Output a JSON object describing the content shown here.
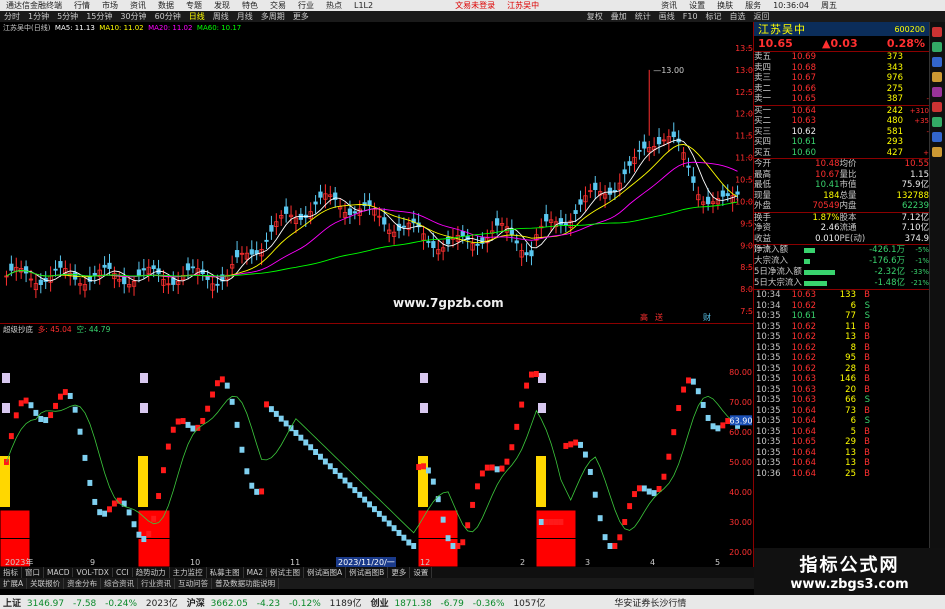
{
  "titlebar": {
    "app": "通达信金融终端",
    "menus": [
      "行情",
      "市场",
      "资讯",
      "数据",
      "专题",
      "发现",
      "特色",
      "交易",
      "行业",
      "热点",
      "L1L2"
    ],
    "trade_login": "文易未登录",
    "stock_name": "江苏吴中",
    "right": [
      "资讯",
      "设置",
      "换肤",
      "服务",
      "10:36:04",
      "周五"
    ]
  },
  "toolbar": {
    "periods": [
      "分时",
      "1分钟",
      "5分钟",
      "15分钟",
      "30分钟",
      "60分钟",
      "日线",
      "周线",
      "月线",
      "多周期",
      "更多"
    ],
    "active": "日线",
    "right": [
      "复权",
      "叠加",
      "统计",
      "画线",
      "F10",
      "标记",
      "自选",
      "返回"
    ]
  },
  "chart_info": {
    "stock": "江苏吴中(日线)",
    "ma5": "MA5: 11.13",
    "ma10": "MA10: 11.02",
    "ma20": "MA20: 11.02",
    "ma60": "MA60: 10.17"
  },
  "price_axis": [
    "13.50",
    "13.00",
    "12.50",
    "12.00",
    "11.50",
    "11.00",
    "10.50",
    "10.00",
    "9.50",
    "9.00",
    "8.50",
    "8.00",
    "7.50"
  ],
  "indicator_axis": [
    "80.00",
    "70.00",
    "60.00",
    "50.00",
    "40.00",
    "30.00",
    "20.00"
  ],
  "indicator_marker": "63.90",
  "high_label": "13.00",
  "watermark_top": "www.7gpzb.com",
  "indicator_head": {
    "name": "超级抄底",
    "v1": "多: 45.04",
    "v2": "空: 44.79"
  },
  "date_labels": [
    "2023年",
    "9",
    "10",
    "11",
    "2023/11/20/一",
    "12",
    "2",
    "3",
    "4",
    "5"
  ],
  "events": [
    "高",
    "送",
    "财"
  ],
  "side": {
    "name": "江苏吴中",
    "code": "600200",
    "price": "10.65",
    "change": "▲0.03",
    "pct": "0.28%",
    "asks": [
      {
        "label": "卖五",
        "price": "10.69",
        "vol": "373",
        "delta": ""
      },
      {
        "label": "卖四",
        "price": "10.68",
        "vol": "343",
        "delta": ""
      },
      {
        "label": "卖三",
        "price": "10.67",
        "vol": "976",
        "delta": ""
      },
      {
        "label": "卖二",
        "price": "10.66",
        "vol": "275",
        "delta": ""
      },
      {
        "label": "卖一",
        "price": "10.65",
        "vol": "387",
        "delta": "-"
      }
    ],
    "bids": [
      {
        "label": "买一",
        "price": "10.64",
        "vol": "242",
        "delta": "+310"
      },
      {
        "label": "买二",
        "price": "10.63",
        "vol": "480",
        "delta": "+35"
      },
      {
        "label": "买三",
        "price": "10.62",
        "vol": "581",
        "delta": "-"
      },
      {
        "label": "买四",
        "price": "10.61",
        "vol": "293",
        "delta": ""
      },
      {
        "label": "买五",
        "price": "10.60",
        "vol": "427",
        "delta": "+"
      }
    ],
    "stats": [
      {
        "k1": "今开",
        "v1": "10.48",
        "k2": "均价",
        "v2": "10.55"
      },
      {
        "k1": "最高",
        "v1": "10.67",
        "k2": "量比",
        "v2": "1.15"
      },
      {
        "k1": "最低",
        "v1": "10.41",
        "k2": "市值",
        "v2": "75.9亿"
      },
      {
        "k1": "现量",
        "v1": "184",
        "k2": "总量",
        "v2": "132788"
      },
      {
        "k1": "外盘",
        "v1": "70549",
        "k2": "内盘",
        "v2": "62239"
      }
    ],
    "stats2": [
      {
        "k1": "换手",
        "v1": "1.87%",
        "k2": "股本",
        "v2": "7.12亿"
      },
      {
        "k1": "净资",
        "v1": "2.46",
        "k2": "流通",
        "v2": "7.10亿"
      },
      {
        "k1": "收益(一)",
        "v1": "0.010",
        "k2": "PE(动)",
        "v2": "374.9"
      }
    ],
    "flows": [
      {
        "label": "净流入额",
        "value": "-426.1万",
        "pct": "-5%",
        "bar": 0.2
      },
      {
        "label": "大宗流入",
        "value": "-176.6万",
        "pct": "-1%",
        "bar": 0.1
      },
      {
        "label": "5日净流入额",
        "value": "-2.32亿",
        "pct": "-33%",
        "bar": 0.55
      },
      {
        "label": "5日大宗流入",
        "value": "-1.48亿",
        "pct": "-21%",
        "bar": 0.4
      }
    ],
    "ticks": [
      {
        "t": "10:34",
        "p": "10.63",
        "v": "133",
        "d": "B"
      },
      {
        "t": "10:34",
        "p": "10.62",
        "v": "6",
        "d": "S"
      },
      {
        "t": "10:35",
        "p": "10.61",
        "v": "77",
        "d": "S"
      },
      {
        "t": "10:35",
        "p": "10.62",
        "v": "11",
        "d": "B"
      },
      {
        "t": "10:35",
        "p": "10.62",
        "v": "13",
        "d": "B"
      },
      {
        "t": "10:35",
        "p": "10.62",
        "v": "8",
        "d": "B"
      },
      {
        "t": "10:35",
        "p": "10.62",
        "v": "95",
        "d": "B"
      },
      {
        "t": "10:35",
        "p": "10.62",
        "v": "28",
        "d": "B"
      },
      {
        "t": "10:35",
        "p": "10.63",
        "v": "146",
        "d": "B"
      },
      {
        "t": "10:35",
        "p": "10.63",
        "v": "20",
        "d": "B"
      },
      {
        "t": "10:35",
        "p": "10.63",
        "v": "66",
        "d": "S"
      },
      {
        "t": "10:35",
        "p": "10.64",
        "v": "73",
        "d": "B"
      },
      {
        "t": "10:35",
        "p": "10.64",
        "v": "6",
        "d": "S"
      },
      {
        "t": "10:35",
        "p": "10.64",
        "v": "5",
        "d": "B"
      },
      {
        "t": "10:35",
        "p": "10.65",
        "v": "29",
        "d": "B"
      },
      {
        "t": "10:35",
        "p": "10.64",
        "v": "13",
        "d": "B"
      },
      {
        "t": "10:35",
        "p": "10.64",
        "v": "13",
        "d": "B"
      },
      {
        "t": "10:36",
        "p": "10.64",
        "v": "25",
        "d": "B"
      }
    ]
  },
  "bottom_tabs": [
    "指标",
    "窗口",
    "MACD",
    "VOL-TDX",
    "CCI",
    "趋势动力",
    "主力监控",
    "私募主图",
    "MA2",
    "例试主图",
    "例试画图A",
    "例试画图B",
    "更多",
    "设置"
  ],
  "bottom_tabs2": [
    "扩展A",
    "关联报价",
    "资金分布",
    "综合资讯",
    "行业资讯",
    "互动问答",
    "普及数据功能说明"
  ],
  "statusbar": {
    "items": [
      {
        "name": "上证",
        "val": "3146.97",
        "chg": "-7.58",
        "pct": "-0.24%",
        "amt": "2023亿"
      },
      {
        "name": "沪深",
        "val": "3662.05",
        "chg": "-4.23",
        "pct": "-0.12%",
        "amt": "1189亿"
      },
      {
        "name": "创业",
        "val": "1871.38",
        "chg": "-6.79",
        "pct": "-0.36%",
        "amt": "1057亿"
      }
    ],
    "broker": "华安证券长沙行情"
  },
  "brand": {
    "title": "指标公式网",
    "url": "www.zbgs3.com"
  },
  "colors": {
    "up": "#ff3030",
    "down": "#5bc8f0",
    "ma5": "#ffffff",
    "ma10": "#ffff00",
    "ma20": "#ff00ff",
    "ma60": "#00ff00",
    "frame": "#8b0000"
  }
}
